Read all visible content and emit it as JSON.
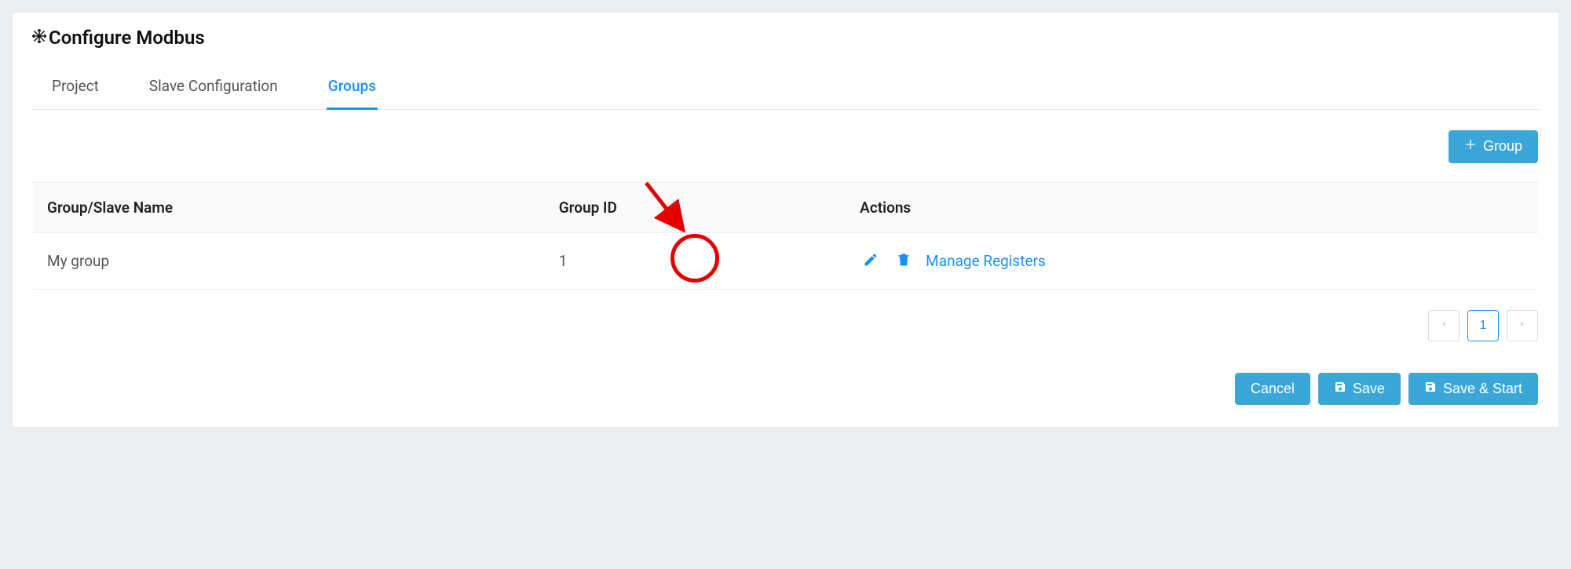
{
  "title": "Configure Modbus",
  "tabs": [
    {
      "label": "Project",
      "active": false
    },
    {
      "label": "Slave Configuration",
      "active": false
    },
    {
      "label": "Groups",
      "active": true
    }
  ],
  "buttons": {
    "add_group": "Group",
    "cancel": "Cancel",
    "save": "Save",
    "save_start": "Save & Start"
  },
  "table": {
    "headers": {
      "name": "Group/Slave Name",
      "id": "Group ID",
      "actions": "Actions"
    },
    "rows": [
      {
        "name": "My group",
        "id": "1",
        "manage": "Manage Registers"
      }
    ]
  },
  "pagination": {
    "current": "1"
  }
}
